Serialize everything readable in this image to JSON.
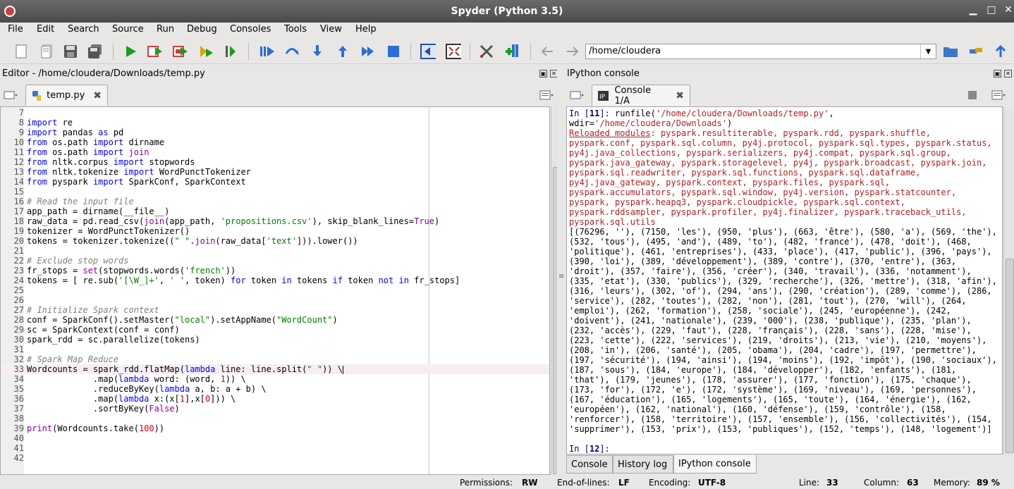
{
  "window": {
    "title": "Spyder (Python 3.5)"
  },
  "menu": [
    "File",
    "Edit",
    "Search",
    "Source",
    "Run",
    "Debug",
    "Consoles",
    "Tools",
    "View",
    "Help"
  ],
  "path": {
    "value": "/home/cloudera"
  },
  "editor": {
    "header": "Editor - /home/cloudera/Downloads/temp.py",
    "tab": "temp.py"
  },
  "console": {
    "header": "IPython console",
    "tab": "Console 1/A"
  },
  "bottom_tabs": [
    "Console",
    "History log",
    "IPython console"
  ],
  "status": {
    "permissions_label": "Permissions:",
    "permissions": "RW",
    "eol_label": "End-of-lines:",
    "eol": "LF",
    "encoding_label": "Encoding:",
    "encoding": "UTF-8",
    "line_label": "Line:",
    "line": "33",
    "column_label": "Column:",
    "column": "63",
    "memory_label": "Memory:",
    "memory": "89 %"
  },
  "colors": {
    "keyword": "#0000ff",
    "builtin": "#900090",
    "string": "#008000",
    "comment": "#7f7f7f",
    "number": "#e00000",
    "console_red": "#b22222"
  },
  "code_lines": [
    {
      "n": "7",
      "t": ""
    },
    {
      "n": "8",
      "t": "import re"
    },
    {
      "n": "9",
      "t": "import pandas as pd"
    },
    {
      "n": "10",
      "t": "from os.path import dirname"
    },
    {
      "n": "11",
      "t": "from os.path import join"
    },
    {
      "n": "12",
      "t": "from nltk.corpus import stopwords"
    },
    {
      "n": "13",
      "t": "from nltk.tokenize import WordPunctTokenizer"
    },
    {
      "n": "14",
      "t": "from pyspark import SparkConf, SparkContext"
    },
    {
      "n": "15",
      "t": ""
    },
    {
      "n": "16",
      "t": "# Read the input file"
    },
    {
      "n": "17",
      "t": "app_path = dirname(__file__)"
    },
    {
      "n": "18",
      "t": "raw_data = pd.read_csv(join(app_path, 'propositions.csv'), skip_blank_lines=True)"
    },
    {
      "n": "19",
      "t": "tokenizer = WordPunctTokenizer()"
    },
    {
      "n": "20",
      "t": "tokens = tokenizer.tokenize((\" \".join(raw_data['text'])).lower())"
    },
    {
      "n": "21",
      "t": ""
    },
    {
      "n": "22",
      "t": "# Exclude stop words"
    },
    {
      "n": "23",
      "t": "fr_stops = set(stopwords.words('french'))"
    },
    {
      "n": "24",
      "t": "tokens = [ re.sub('[\\W_]+', ' ', token) for token in tokens if token not in fr_stops]"
    },
    {
      "n": "25",
      "t": ""
    },
    {
      "n": "26",
      "t": ""
    },
    {
      "n": "27",
      "t": "# Initialize Spark context"
    },
    {
      "n": "28",
      "t": "conf = SparkConf().setMaster(\"local\").setAppName(\"WordCount\")"
    },
    {
      "n": "29",
      "t": "sc = SparkContext(conf = conf)"
    },
    {
      "n": "30",
      "t": "spark_rdd = sc.parallelize(tokens)"
    },
    {
      "n": "31",
      "t": ""
    },
    {
      "n": "32",
      "t": "# Spark Map Reduce"
    },
    {
      "n": "33",
      "t": "Wordcounts = spark_rdd.flatMap(lambda line: line.split(\" \")) \\"
    },
    {
      "n": "34",
      "t": "             .map(lambda word: (word, 1)) \\"
    },
    {
      "n": "35",
      "t": "             .reduceByKey(lambda a, b: a + b) \\"
    },
    {
      "n": "36",
      "t": "             .map(lambda x:(x[1],x[0])) \\"
    },
    {
      "n": "37",
      "t": "             .sortByKey(False)"
    },
    {
      "n": "38",
      "t": ""
    },
    {
      "n": "39",
      "t": "print(Wordcounts.take(100))"
    },
    {
      "n": "40",
      "t": ""
    },
    {
      "n": "41",
      "t": ""
    },
    {
      "n": "42",
      "t": ""
    }
  ],
  "console_output": {
    "in11_label": "In [",
    "in11_num": "11",
    "in11_end": "]: ",
    "in11_cmd": "runfile('/home/cloudera/Downloads/temp.py',",
    "in11_wdir": "wdir='/home/cloudera/Downloads')",
    "reloaded_label": "Reloaded modules",
    "reloaded_lines": [
      ": pyspark.resultiterable, pyspark.rdd, pyspark.shuffle,",
      "pyspark.conf, pyspark.sql.column, py4j.protocol, pyspark.sql.types, pyspark.status,",
      "py4j.java_collections, pyspark.serializers, py4j.compat, pyspark.sql.group,",
      "pyspark.java_gateway, pyspark.storagelevel, py4j, pyspark.broadcast, pyspark.join,",
      "pyspark.sql.readwriter, pyspark.sql.functions, pyspark.sql.dataframe,",
      "py4j.java_gateway, pyspark.context, pyspark.files, pyspark.sql,",
      "pyspark.accumulators, pyspark.sql.window, py4j.version, pyspark.statcounter,",
      "pyspark, pyspark.heapq3, pyspark.cloudpickle, pyspark.sql.context,",
      "pyspark.rddsampler, pyspark.profiler, py4j.finalizer, pyspark.traceback_utils,",
      "pyspark.sql.utils"
    ],
    "result_lines": [
      "[(76296, ''), (7150, 'les'), (950, 'plus'), (663, 'être'), (580, 'a'), (569, 'the'),",
      "(532, 'tous'), (495, 'and'), (489, 'to'), (482, 'france'), (478, 'doit'), (468,",
      "'politique'), (461, 'entreprises'), (433, 'place'), (417, 'public'), (396, 'pays'),",
      "(390, 'loi'), (389, 'développement'), (389, 'contre'), (370, 'entre'), (363,",
      "'droit'), (357, 'faire'), (356, 'créer'), (340, 'travail'), (336, 'notamment'),",
      "(335, 'etat'), (330, 'publics'), (329, 'recherche'), (326, 'mettre'), (318, 'afin'),",
      "(316, 'leurs'), (302, 'of'), (294, 'ans'), (290, 'création'), (289, 'comme'), (286,",
      "'service'), (282, 'toutes'), (282, 'non'), (281, 'tout'), (270, 'will'), (264,",
      "'emploi'), (262, 'formation'), (258, 'sociale'), (245, 'européenne'), (242,",
      "'doivent'), (241, 'nationale'), (239, '000'), (238, 'publique'), (235, 'plan'),",
      "(232, 'accès'), (229, 'faut'), (228, 'français'), (228, 'sans'), (228, 'mise'),",
      "(223, 'cette'), (222, 'services'), (219, 'droits'), (213, 'vie'), (210, 'moyens'),",
      "(208, 'in'), (206, 'santé'), (205, 'obama'), (204, 'cadre'), (197, 'permettre'),",
      "(197, 'sécurité'), (194, 'ainsi'), (194, 'moins'), (192, 'impôt'), (190, 'sociaux'),",
      "(187, 'sous'), (184, 'europe'), (184, 'développer'), (182, 'enfants'), (181,",
      "'that'), (179, 'jeunes'), (178, 'assurer'), (177, 'fonction'), (175, 'chaque'),",
      "(173, 'for'), (172, 'e'), (172, 'système'), (169, 'niveau'), (169, 'personnes'),",
      "(167, 'éducation'), (165, 'logements'), (165, 'toute'), (164, 'énergie'), (162,",
      "'européen'), (162, 'national'), (160, 'défense'), (159, 'contrôle'), (158,",
      "'renforcer'), (158, 'territoire'), (157, 'ensemble'), (156, 'collectivités'), (154,",
      "'supprimer'), (153, 'prix'), (153, 'publiques'), (152, 'temps'), (148, 'logement')]"
    ],
    "in12_label": "In [",
    "in12_num": "12",
    "in12_end": "]:"
  },
  "icons": [
    "new-file-icon",
    "open-file-icon",
    "save-icon",
    "save-all-icon",
    "run-icon",
    "run-cell-icon",
    "run-cell-advance-icon",
    "run-selection-icon",
    "profile-icon",
    "debug-icon",
    "step-icon",
    "step-into-icon",
    "step-return-icon",
    "continue-icon",
    "stop-debug-icon",
    "maximize-pane-icon",
    "fullscreen-icon",
    "preferences-icon",
    "pythonpath-icon",
    "back-arrow-icon",
    "forward-arrow-icon",
    "browse-folder-icon",
    "set-working-dir-icon",
    "parent-dir-icon"
  ]
}
